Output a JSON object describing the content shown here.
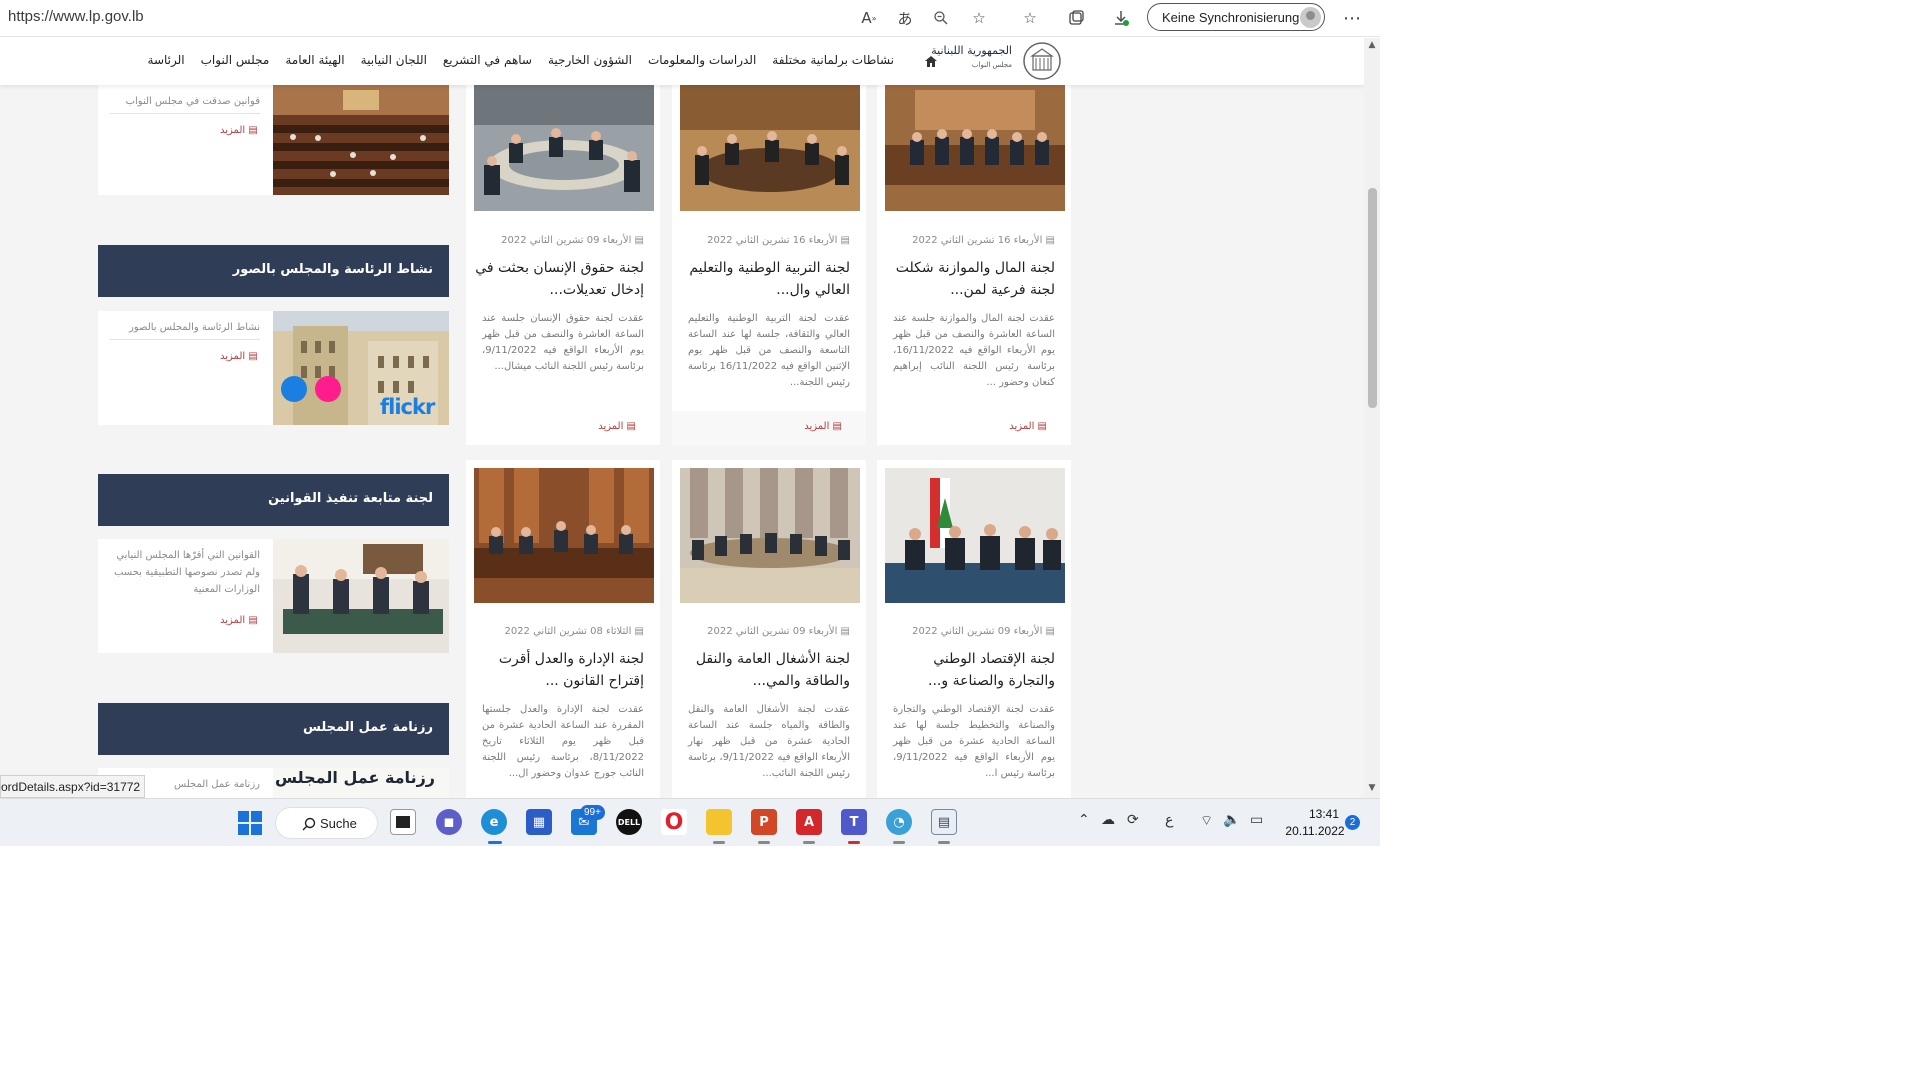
{
  "browser": {
    "url": "https://www.lp.gov.lb",
    "sync_label": "Keine Synchronisierung",
    "icons": [
      "read-aloud-icon",
      "translate-icon",
      "zoom-icon",
      "favorite-add-icon",
      "favorites-icon",
      "collections-icon",
      "downloads-icon",
      "more-icon"
    ]
  },
  "site": {
    "logo_title": "الجمهورية اللبنانية",
    "logo_subtitle": "مجلس النواب",
    "nav": [
      "الرئاسة",
      "مجلس النواب",
      "الهيئة العامة",
      "اللجان النيابية",
      "ساهم في التشريع",
      "الشؤون الخارجية",
      "الدراسات والمعلومات",
      "نشاطات برلمانية مختلفة"
    ]
  },
  "sidebar": {
    "laws": {
      "text": "قوانين صدقت في مجلس النواب",
      "more": "المزيد"
    },
    "photos": {
      "title": "نشاط الرئاسة والمجلس بالصور",
      "text": "نشاط الرئاسة والمجلس بالصور",
      "more": "المزيد",
      "flickr": "flickr"
    },
    "followup": {
      "title": "لجنة متابعة تنفيذ القوانين",
      "text": "القوانين التي أقرّها المجلس النيابي ولم تصدر نصوصها التطبيقية بحسب الوزارات المعنية",
      "more": "المزيد"
    },
    "agenda": {
      "title": "رزنامة عمل المجلس",
      "text": "رزنامة عمل المجلس",
      "banner": "رزنامة عمل المجلس"
    }
  },
  "articles": [
    {
      "date": "الأربعاء 16 تشرين الثاني 2022",
      "title": "لجنة المال والموازنة شكلت لجنة فرعية لمن...",
      "body": "عقدت لجنة المال والموازنة جلسة عند الساعة العاشرة والنصف من قبل ظهر يوم الأربعاء الواقع فيه 16/11/2022، برئاسة رئيس اللجنة النائب إبراهيم كنعان وحضور ...",
      "more": "المزيد"
    },
    {
      "date": "الأربعاء 16 تشرين الثاني 2022",
      "title": "لجنة التربية الوطنية والتعليم العالي وال...",
      "body": "عقدت لجنة التربية الوطنية والتعليم العالي والثقافة، جلسة لها عند الساعة التاسعة والنصف من قبل ظهر يوم الإثنين الواقع فيه 16/11/2022 برئاسة رئيس اللجنة...",
      "more": "المزيد"
    },
    {
      "date": "الأربعاء 09 تشرين الثاني 2022",
      "title": "لجنة حقوق الإنسان بحثت في إدخال تعديلات...",
      "body": "عقدت لجنة حقوق الإنسان جلسة عند الساعة العاشرة والنصف من قبل ظهر يوم الأربعاء الواقع فيه 9/11/2022، برئاسة رئيس اللجنة النائب ميشال...",
      "more": "المزيد"
    },
    {
      "date": "الأربعاء 09 تشرين الثاني 2022",
      "title": "لجنة الإقتصاد الوطني والتجارة والصناعة و...",
      "body": "عقدت لجنة الإقتصاد الوطني والتجارة والصناعة والتخطيط جلسة لها عند الساعة الحادية عشرة من قبل ظهر يوم الأربعاء الواقع فيه 9/11/2022، برئاسة رئيس ا...",
      "more": "المزيد"
    },
    {
      "date": "الأربعاء 09 تشرين الثاني 2022",
      "title": "لجنة الأشغال العامة والنقل والطاقة والمي...",
      "body": "عقدت لجنة الأشغال العامة والنقل والطاقة والمياه جلسة عند الساعة الحادية عشرة من قبل ظهر نهار الأربعاء الواقع فيه 9/11/2022، برئاسة رئيس اللجنة النائب...",
      "more": "المزيد"
    },
    {
      "date": "الثلاثاء 08 تشرين الثاني 2022",
      "title": "لجنة الإدارة والعدل أقرت إقتراح القانون ...",
      "body": "عقدت لجنة الإدارة والعدل جلستها المقررة عند الساعة الحادية عشرة من قبل ظهر يوم الثلاثاء تاريخ 8/11/2022، برئاسة رئيس اللجنة النائب جورج عدوان وحضور ال...",
      "more": "المزيد"
    }
  ],
  "status_url": "ordDetails.aspx?id=31772",
  "taskbar": {
    "search_label": "Suche",
    "mail_badge": "99+",
    "time": "13:41",
    "date": "20.11.2022",
    "notifications": "2",
    "lang": "ع"
  },
  "colors": {
    "widget_header": "#2f3e56",
    "more_link": "#b23c3c",
    "page_bg": "#f4f4f4"
  }
}
